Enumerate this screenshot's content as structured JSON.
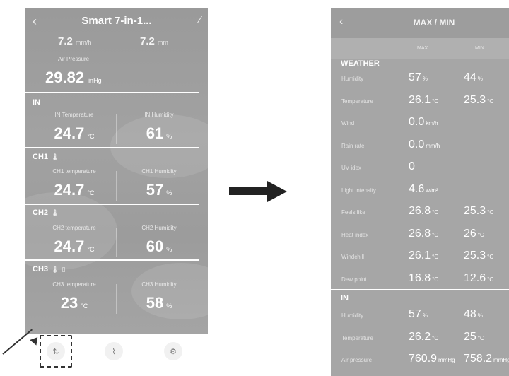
{
  "left_screen": {
    "header": {
      "title": "Smart 7-in-1..."
    },
    "partial_row": {
      "left_unit": "mm/h",
      "right_unit": "mm"
    },
    "air_pressure": {
      "label": "Air Pressure",
      "value": "29.82",
      "unit": "inHg"
    },
    "sections": [
      {
        "title": "IN",
        "left_label": "IN Temperature",
        "left_value": "24.7",
        "left_unit": "°C",
        "right_label": "IN Humidity",
        "right_value": "61",
        "right_unit": "%"
      },
      {
        "title": "CH1",
        "left_label": "CH1 temperature",
        "left_value": "24.7",
        "left_unit": "°C",
        "right_label": "CH1 Humidity",
        "right_value": "57",
        "right_unit": "%"
      },
      {
        "title": "CH2",
        "left_label": "CH2 temperature",
        "left_value": "24.7",
        "left_unit": "°C",
        "right_label": "CH2 Humidity",
        "right_value": "60",
        "right_unit": "%"
      },
      {
        "title": "CH3",
        "left_label": "CH3 temperature",
        "left_value": "23",
        "left_unit": "°C",
        "right_label": "CH3 Humidity",
        "right_value": "58",
        "right_unit": "%"
      }
    ],
    "bottom_nav": [
      "max-min-icon",
      "chart-icon",
      "settings-icon"
    ]
  },
  "right_screen": {
    "header": {
      "title": "MAX / MIN"
    },
    "columns": {
      "max": "MAX",
      "min": "MIN"
    },
    "weather_title": "WEATHER",
    "weather_rows": [
      {
        "name": "Humidity",
        "max": "57",
        "max_unit": "%",
        "min": "44",
        "min_unit": "%"
      },
      {
        "name": "Temperature",
        "max": "26.1",
        "max_unit": "°C",
        "min": "25.3",
        "min_unit": "°C"
      },
      {
        "name": "Wind",
        "max": "0.0",
        "max_unit": "km/h",
        "min": "",
        "min_unit": ""
      },
      {
        "name": "Rain rate",
        "max": "0.0",
        "max_unit": "mm/h",
        "min": "",
        "min_unit": ""
      },
      {
        "name": "UV idex",
        "max": "0",
        "max_unit": "",
        "min": "",
        "min_unit": ""
      },
      {
        "name": "Light intensity",
        "max": "4.6",
        "max_unit": "w/m²",
        "min": "",
        "min_unit": ""
      },
      {
        "name": "Feels like",
        "max": "26.8",
        "max_unit": "°C",
        "min": "25.3",
        "min_unit": "°C"
      },
      {
        "name": "Heat index",
        "max": "26.8",
        "max_unit": "°C",
        "min": "26",
        "min_unit": "°C"
      },
      {
        "name": "Windchill",
        "max": "26.1",
        "max_unit": "°C",
        "min": "25.3",
        "min_unit": "°C"
      },
      {
        "name": "Dew point",
        "max": "16.8",
        "max_unit": "°C",
        "min": "12.6",
        "min_unit": "°C"
      }
    ],
    "in_title": "IN",
    "in_rows": [
      {
        "name": "Humidity",
        "max": "57",
        "max_unit": "%",
        "min": "48",
        "min_unit": "%"
      },
      {
        "name": "Temperature",
        "max": "26.2",
        "max_unit": "°C",
        "min": "25",
        "min_unit": "°C"
      },
      {
        "name": "Air pressure",
        "max": "760.9",
        "max_unit": "mmHg",
        "min": "758.2",
        "min_unit": "mmHg"
      }
    ]
  },
  "colors": {
    "screen_gray": "#a0a0a0",
    "header_gray": "#9d9d9d",
    "column_header_gray": "#b0b0b0",
    "arrow": "#222222",
    "text": "#ffffff"
  }
}
